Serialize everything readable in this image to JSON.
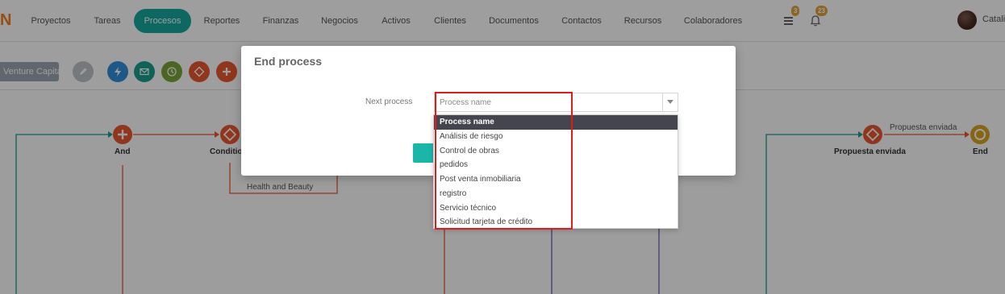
{
  "nav": {
    "brand_char": "N",
    "items": [
      "Proyectos",
      "Tareas",
      "Procesos",
      "Reportes",
      "Finanzas",
      "Negocios",
      "Activos",
      "Clientes",
      "Documentos",
      "Contactos",
      "Recursos",
      "Colaboradores"
    ],
    "active": "Procesos",
    "tasks_badge": "3",
    "notifications_badge": "23",
    "user_name": "Catalina"
  },
  "toolbar": {
    "tag_label": "Venture Capital",
    "buttons": [
      "edit-icon",
      "lightning-icon",
      "mail-icon",
      "clock-icon",
      "diamond-icon",
      "plus-icon"
    ]
  },
  "diagram": {
    "nodes": [
      "And",
      "Condition",
      "Propuesta enviada",
      "End"
    ],
    "edge_labels": [
      "Health and Beauty",
      "Propuesta enviada"
    ]
  },
  "modal": {
    "title": "End process",
    "field_label": "Next process",
    "select_placeholder": "Process name"
  },
  "dropdown": {
    "options": [
      "Process name",
      "Análisis de riesgo",
      "Control de obras",
      "pedidos",
      "Post venta inmobiliaria",
      "registro",
      "Servicio técnico",
      "Solicitud tarjeta de crédito"
    ],
    "selected_index": 0
  },
  "colors": {
    "accent": "#16a99f",
    "orange": "#e8582f",
    "yellow": "#d9a520",
    "highlight": "#e01b1b"
  }
}
